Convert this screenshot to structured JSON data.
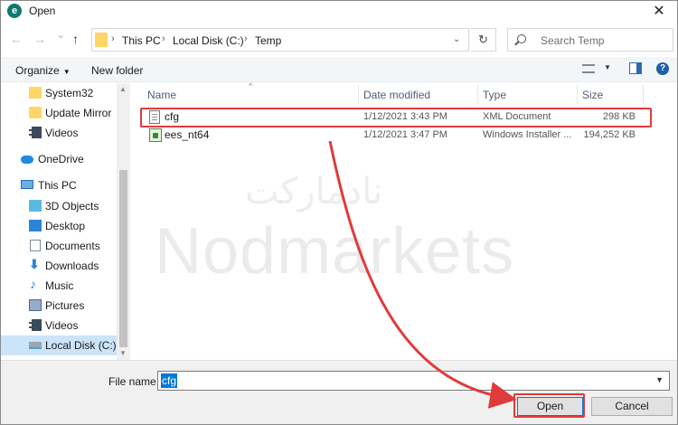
{
  "window": {
    "title": "Open",
    "app_icon_letter": "e",
    "close_glyph": "✕"
  },
  "nav": {
    "back_glyph": "←",
    "forward_glyph": "→",
    "recent_glyph": "⌄",
    "up_glyph": "↑",
    "breadcrumbs": [
      "This PC",
      "Local Disk (C:)",
      "Temp"
    ],
    "separator": "›",
    "dropdown_glyph": "⌄",
    "refresh_glyph": "↻",
    "search_placeholder": "Search Temp"
  },
  "toolbar": {
    "organize_label": "Organize",
    "new_folder_label": "New folder",
    "help_glyph": "?"
  },
  "sidebar": {
    "items": [
      {
        "label": "System32",
        "icon": "folder-icon"
      },
      {
        "label": "Update Mirror",
        "icon": "folder-icon"
      },
      {
        "label": "Videos",
        "icon": "video-icon"
      },
      {
        "label": "OneDrive",
        "icon": "cloud-icon"
      },
      {
        "label": "This PC",
        "icon": "computer-icon"
      },
      {
        "label": "3D Objects",
        "icon": "3d-objects-icon"
      },
      {
        "label": "Desktop",
        "icon": "desktop-icon"
      },
      {
        "label": "Documents",
        "icon": "documents-icon"
      },
      {
        "label": "Downloads",
        "icon": "download-arrow-icon"
      },
      {
        "label": "Music",
        "icon": "music-note-icon"
      },
      {
        "label": "Pictures",
        "icon": "pictures-icon"
      },
      {
        "label": "Videos",
        "icon": "video-icon"
      },
      {
        "label": "Local Disk (C:)",
        "icon": "drive-icon",
        "selected": true
      }
    ],
    "download_glyph": "⬇",
    "music_glyph": "♪"
  },
  "columns": {
    "name": "Name",
    "date": "Date modified",
    "type": "Type",
    "size": "Size"
  },
  "files": [
    {
      "name": "cfg",
      "date": "1/12/2021 3:43 PM",
      "type": "XML Document",
      "size": "298 KB",
      "icon": "xml-file-icon"
    },
    {
      "name": "ees_nt64",
      "date": "1/12/2021 3:47 PM",
      "type": "Windows Installer ...",
      "size": "194,252 KB",
      "icon": "installer-icon"
    }
  ],
  "watermark": {
    "arabic": "نادمارکت",
    "english": "Nodmarkets"
  },
  "footer": {
    "file_name_label": "File name:",
    "file_name_value": "cfg",
    "open_label": "Open",
    "cancel_label": "Cancel"
  },
  "colors": {
    "highlight": "#e03b3b",
    "accent": "#0078d7",
    "selection": "#cce4f7"
  }
}
